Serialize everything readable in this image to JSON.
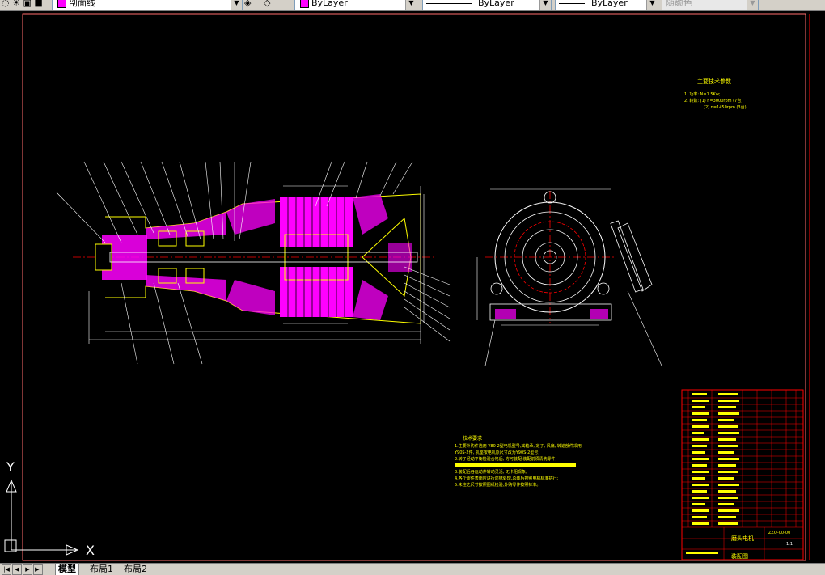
{
  "toolbar": {
    "layer_name": "剖面线",
    "color_control": "ByLayer",
    "linetype_control": "ByLayer",
    "lineweight_control": "ByLayer",
    "plotstyle_control": "随颜色"
  },
  "tabs": {
    "model": "模型",
    "layout1": "布局1",
    "layout2": "布局2"
  },
  "ucs": {
    "x_label": "X",
    "y_label": "Y"
  },
  "drawing": {
    "params_title": "主要技术参数",
    "params_lines": [
      "1. 功率: N=1.5Kw;",
      "2. 转数: (1) n=3000rpm (7台)",
      "(2) n=1450rpm (3台)"
    ],
    "tech_title": "技术要求",
    "tech_lines": [
      "1.主要外购件选用 Y80-2型电机型号,其轴承, 定子, 风扇, 转速部件采用",
      "Y90S-2件, 机座按电机原尺寸改为Y90S-2型号;",
      "2.转子经动平衡检验合格后, 方可装配,装配前须清洗零件;",
      "3.装配后各运动件转动灵活, 无卡阻现象;",
      "4.各个零件表面应进行防锈处理,总装后按照电机标准执行;",
      "5.未注之尺寸按照图纸检验,外购零件按照标准。"
    ],
    "title_block": {
      "name": "磨头电机",
      "subtitle": "装配图",
      "code": "ZZQ-00-00",
      "scale": "1:1"
    }
  },
  "colors": {
    "background": "#000000",
    "outline": "#ffff00",
    "section": "#ff00ff",
    "dimension": "#ffffff",
    "frame": "#ff0000",
    "center": "#ff0000"
  }
}
